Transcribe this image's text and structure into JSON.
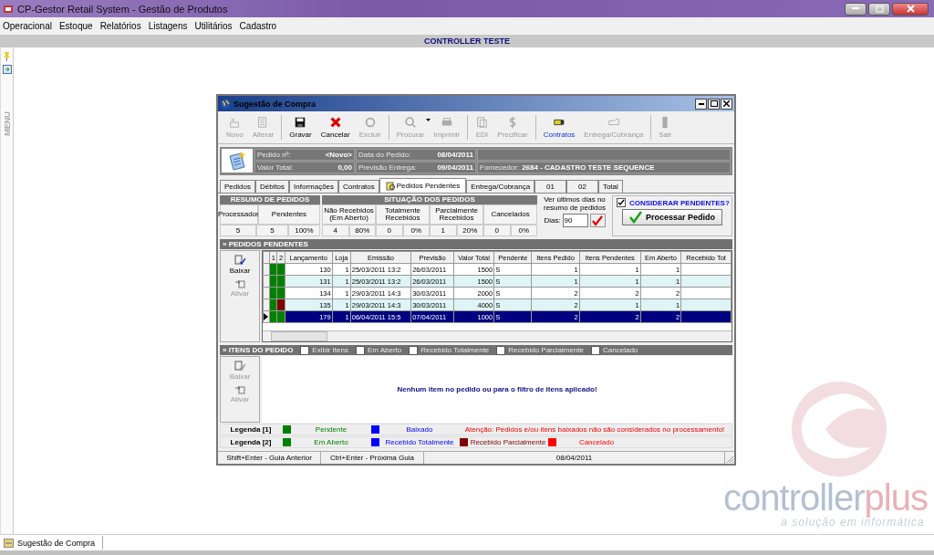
{
  "app_window": {
    "title": "CP-Gestor Retail System - Gestão de Produtos"
  },
  "menu": [
    "Operacional",
    "Estoque",
    "Relatórios",
    "Listagens",
    "Utilitários",
    "Cadastro"
  ],
  "banner": "CONTROLLER TESTE",
  "side_strip": {
    "label": "MENU"
  },
  "dialog": {
    "title": "Sugestão de Compra",
    "toolbar": [
      {
        "label": "Novo",
        "kind": "new",
        "disabled": true
      },
      {
        "label": "Alterar",
        "kind": "edit",
        "disabled": true
      },
      {
        "label": "Gravar",
        "kind": "save",
        "disabled": false
      },
      {
        "label": "Cancelar",
        "kind": "cancel",
        "disabled": false
      },
      {
        "label": "Excluir",
        "kind": "delete",
        "disabled": true
      },
      {
        "label": "Procurar",
        "kind": "search",
        "disabled": true
      },
      {
        "label": "Imprimir",
        "kind": "print",
        "disabled": true
      },
      {
        "label": "EDI",
        "kind": "edi",
        "disabled": true
      },
      {
        "label": "Precificar",
        "kind": "price",
        "disabled": true
      },
      {
        "label": "Contratos",
        "kind": "contracts",
        "disabled": false
      },
      {
        "label": "Entrega/Cobrança",
        "kind": "delivery",
        "disabled": true
      },
      {
        "label": "Sair",
        "kind": "exit",
        "disabled": true
      }
    ],
    "header": {
      "pedido_label": "Pedido nº:",
      "pedido_value": "<Novo>",
      "data_label": "Data do Pedido:",
      "data_value": "08/04/2011",
      "valor_label": "Valor Total:",
      "valor_value": "0,00",
      "previsao_label": "Previsão Entrega:",
      "previsao_value": "09/04/2011",
      "fornecedor_label": "Fornecedor:",
      "fornecedor_value": "2684 - CADASTRO TESTE SEQUENCE"
    },
    "tabs": [
      {
        "label": "Pedidos",
        "selected": false
      },
      {
        "label": "Débitos",
        "selected": false
      },
      {
        "label": "Informações",
        "selected": false
      },
      {
        "label": "Contratos",
        "selected": false
      },
      {
        "label": "Pedidos Pendentes",
        "selected": true
      },
      {
        "label": "Entrega/Cobrança",
        "selected": false
      },
      {
        "label": "01",
        "selected": false
      },
      {
        "label": "02",
        "selected": false
      },
      {
        "label": "Total",
        "selected": false
      }
    ],
    "resumo": {
      "title": "RESUMO DE PEDIDOS",
      "columns": [
        "Processados",
        "Pendentes"
      ],
      "values": [
        "5",
        "5",
        "100%"
      ]
    },
    "situacao": {
      "title": "SITUAÇÃO DOS PEDIDOS",
      "columns": [
        "Não Recebidos (Em Aberto)",
        "Totalmente Recebidos",
        "Parcialmente Recebidos",
        "Cancelados"
      ],
      "values": [
        "4",
        "80%",
        "0",
        "0%",
        "1",
        "20%",
        "0",
        "0%"
      ]
    },
    "dias": {
      "caption": "Ver últimos dias no resumo de pedidos",
      "label": "Dias:",
      "value": "90"
    },
    "considerar": {
      "label": "CONSIDERAR PENDENTES?",
      "checked": true
    },
    "process_button": "Processar Pedido",
    "pedidos": {
      "title": "» PEDIDOS PENDENTES",
      "actions": [
        {
          "label": "Baixar",
          "disabled": false
        },
        {
          "label": "Ativar",
          "disabled": true
        }
      ],
      "columns": [
        "1",
        "2",
        "Lançamento",
        "Loja",
        "Emissão",
        "Previsão",
        "Valor Total",
        "Pendente",
        "Itens Pedido",
        "Itens Pendentes",
        "Em Aberto",
        "Recebido Tot"
      ],
      "rows": [
        {
          "selected": false,
          "status": [
            {
              "color": "#008000"
            },
            {
              "color": "#008000"
            }
          ],
          "cells": [
            "",
            "",
            "130",
            "1",
            "25/03/2011 13:2",
            "26/03/2011",
            "1500",
            "S",
            "1",
            "1",
            "1",
            ""
          ]
        },
        {
          "selected": false,
          "status": [
            {
              "color": "#008000"
            },
            {
              "color": "#008000"
            }
          ],
          "cells": [
            "",
            "",
            "131",
            "1",
            "25/03/2011 13:2",
            "26/03/2011",
            "1500",
            "S",
            "1",
            "1",
            "1",
            ""
          ]
        },
        {
          "selected": false,
          "status": [
            {
              "color": "#008000"
            },
            {
              "color": "#008000"
            }
          ],
          "cells": [
            "",
            "",
            "134",
            "1",
            "29/03/2011 14:3",
            "30/03/2011",
            "2000",
            "S",
            "2",
            "2",
            "2",
            ""
          ]
        },
        {
          "selected": false,
          "status": [
            {
              "color": "#008000"
            },
            {
              "color": "#800000"
            }
          ],
          "cells": [
            "",
            "",
            "135",
            "1",
            "29/03/2011 14:3",
            "30/03/2011",
            "4000",
            "S",
            "2",
            "1",
            "1",
            ""
          ]
        },
        {
          "selected": true,
          "status": [
            {
              "color": "#008000"
            },
            {
              "color": "#008000"
            }
          ],
          "cells": [
            "",
            "",
            "179",
            "1",
            "06/04/2011 15:5",
            "07/04/2011",
            "1000",
            "S",
            "2",
            "2",
            "2",
            ""
          ]
        }
      ]
    },
    "itens": {
      "title": "» ITENS DO PEDIDO",
      "filters": [
        {
          "label": "Exibir Itens",
          "checked": false
        },
        {
          "label": "Em Aberto",
          "checked": false
        },
        {
          "label": "Recebido Totalmente",
          "checked": false
        },
        {
          "label": "Recebido Parcialmente",
          "checked": false
        },
        {
          "label": "Cancelado",
          "checked": false
        }
      ],
      "actions": [
        {
          "label": "Baixar",
          "disabled": true
        },
        {
          "label": "Ativar",
          "disabled": true
        }
      ],
      "empty_message": "Nenhum item no pedido ou para o filtro de itens aplicado!"
    },
    "legends": [
      {
        "title": "Legenda [1]",
        "items": [
          {
            "kind": "swatch",
            "label": "Pendente",
            "color": "#008000"
          },
          {
            "kind": "swatch",
            "label": "Baixado",
            "color": "#0000ff"
          },
          {
            "kind": "note",
            "label": "Atenção: Pedidos e/ou itens baixados não são considerados no processamento!"
          }
        ]
      },
      {
        "title": "Legenda [2]",
        "items": [
          {
            "kind": "swatch",
            "label": "Em Aberto",
            "color": "#008000"
          },
          {
            "kind": "swatch",
            "label": "Recebido Totalmente",
            "color": "#0000ff"
          },
          {
            "kind": "swatch",
            "label": "Recebido Parcialmente",
            "color": "#800000"
          },
          {
            "kind": "swatch",
            "label": "Cancelado",
            "color": "#ff0000"
          }
        ]
      }
    ],
    "status_bar": [
      "Shift+Enter - Guia Anterior",
      "Ctrl+Enter - Próxima Guia",
      "08/04/2011"
    ]
  },
  "taskbar": [
    {
      "label": "Sugestão de Compra"
    }
  ],
  "logo": {
    "name_main": "controller",
    "name_accent": "plus",
    "tagline": "a solução em informática"
  }
}
